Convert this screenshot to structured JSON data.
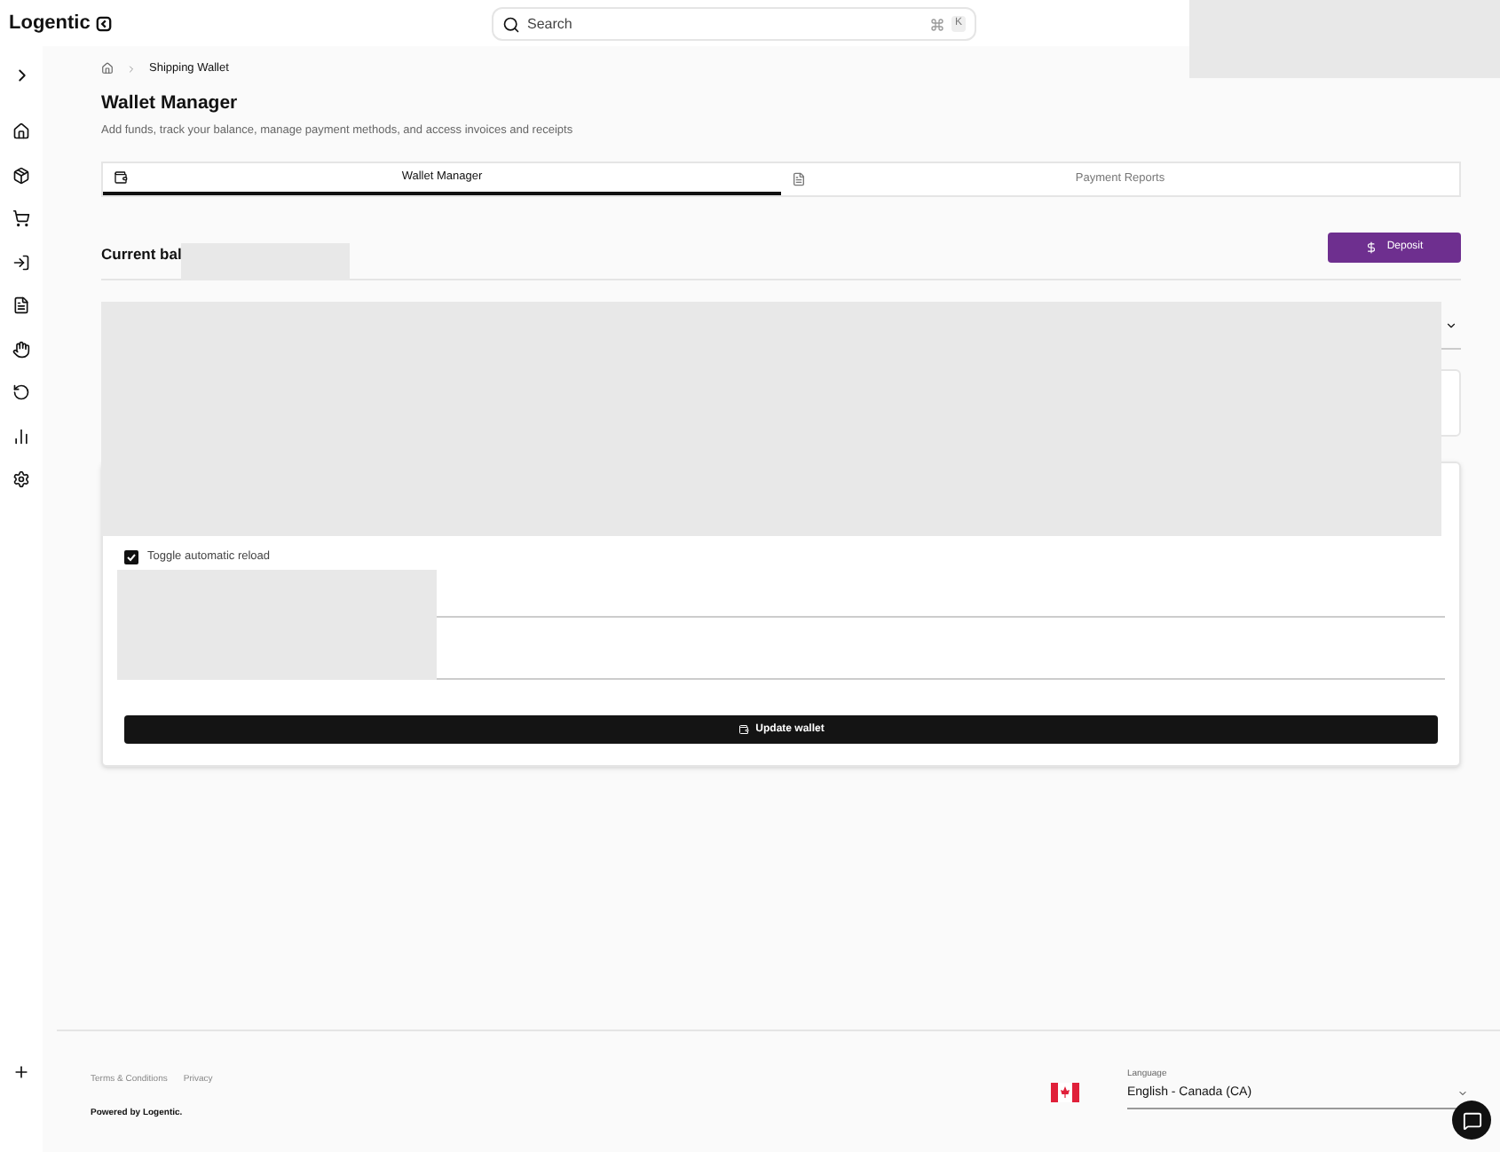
{
  "header": {
    "logo": "Logentic",
    "search": {
      "placeholder": "Search",
      "shortcut_key": "K"
    }
  },
  "breadcrumb": {
    "current": "Shipping Wallet"
  },
  "page": {
    "title": "Wallet Manager",
    "subtitle": "Add funds, track your balance, manage payment methods, and access invoices and receipts"
  },
  "tabs": [
    {
      "label": "Wallet Manager",
      "selected": true
    },
    {
      "label": "Payment Reports",
      "selected": false
    }
  ],
  "balance": {
    "label": "Current bal",
    "deposit_button": "Deposit"
  },
  "auto_reload": {
    "label": "Toggle automatic reload",
    "checked": true
  },
  "update_button": "Update wallet",
  "footer": {
    "links": [
      "Terms & Conditions",
      "Privacy"
    ],
    "powered_by": "Powered by Logentic.",
    "language": {
      "label": "Language",
      "value": "English - Canada (CA)"
    }
  }
}
